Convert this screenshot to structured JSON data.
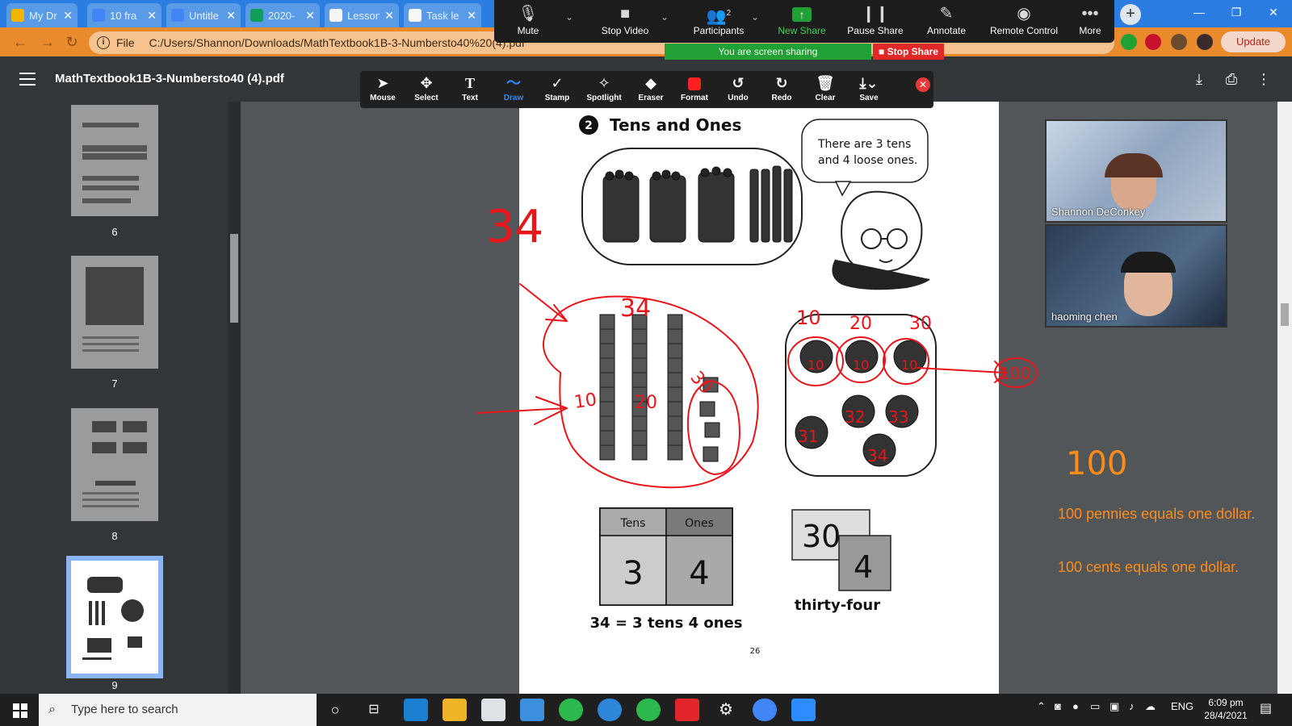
{
  "browser": {
    "tabs": [
      {
        "label": "My Dr",
        "color": "#f4b400"
      },
      {
        "label": "10 fra",
        "color": "#4285f4"
      },
      {
        "label": "Untitle",
        "color": "#4285f4"
      },
      {
        "label": "2020-",
        "color": "#0f9d58"
      },
      {
        "label": "Lesson",
        "color": "#f6f6f6"
      },
      {
        "label": "Task le",
        "color": "#f6f6f6"
      }
    ],
    "new_tab": "+",
    "address_prefix": "File",
    "address": "C:/Users/Shannon/Downloads/MathTextbook1B-3-Numbersto40%20(4).pdf",
    "update_label": "Update"
  },
  "zoom": {
    "buttons": [
      {
        "label": "Mute",
        "icon": "🎙"
      },
      {
        "label": "Stop Video",
        "icon": "■"
      },
      {
        "label": "Participants",
        "icon": "👥"
      },
      {
        "label": "New Share",
        "icon": "↑"
      },
      {
        "label": "Pause Share",
        "icon": "❙❙"
      },
      {
        "label": "Annotate",
        "icon": "✎"
      },
      {
        "label": "Remote Control",
        "icon": "◉"
      },
      {
        "label": "More",
        "icon": "•••"
      }
    ],
    "participant_count": "2",
    "sharing_text": "You are screen sharing",
    "stop_share": "Stop Share"
  },
  "pdf": {
    "title": "MathTextbook1B-3-Numbersto40 (4).pdf",
    "thumbnails": [
      "6",
      "7",
      "8",
      "9"
    ],
    "page_number": "26",
    "section_number": "2",
    "section_title": "Tens and Ones",
    "speech_line1_a": "There are",
    "speech_line1_b": "3",
    "speech_line1_c": "tens",
    "speech_line2_a": "and",
    "speech_line2_b": "4",
    "speech_line2_c": "loose",
    "speech_line2_d": "ones.",
    "table_headers": [
      "Tens",
      "Ones"
    ],
    "table_values": [
      "3",
      "4"
    ],
    "equation": "34 = 3 tens 4 ones",
    "card_tens": "30",
    "card_ones": "4",
    "number_word": "thirty-four"
  },
  "annotate": {
    "tools": [
      "Mouse",
      "Select",
      "Text",
      "Draw",
      "Stamp",
      "Spotlight",
      "Eraser",
      "Format",
      "Undo",
      "Redo",
      "Clear",
      "Save"
    ],
    "active": "Draw",
    "format_color": "#ff2020"
  },
  "handwriting": {
    "big_34": "34",
    "top_34": "34",
    "ten_label": "10",
    "twenty_label": "20",
    "thirty_label": "30",
    "coin_10a": "10",
    "coin_20": "20",
    "coin_30": "30",
    "coin_values": [
      "10",
      "10",
      "10",
      "31",
      "32",
      "33",
      "34"
    ],
    "total_100": "100",
    "orange_100": "100",
    "ink_color": "#e8151b",
    "orange_color": "#ff8c1a"
  },
  "notes": {
    "line1": "100 pennies equals one dollar.",
    "line2": "100 cents equals one dollar."
  },
  "participants": [
    {
      "name": "Shannon DeConkey"
    },
    {
      "name": "haoming chen"
    }
  ],
  "taskbar": {
    "search_placeholder": "Type here to search",
    "lang": "ENG",
    "time": "6:09 pm",
    "date": "28/4/2021",
    "apps": [
      "Edge",
      "Files",
      "Store",
      "Mail",
      "Evernote",
      "Tutor",
      "Evernote",
      "iTutor Group",
      "Settings",
      "Chrome",
      "Zoom"
    ]
  }
}
